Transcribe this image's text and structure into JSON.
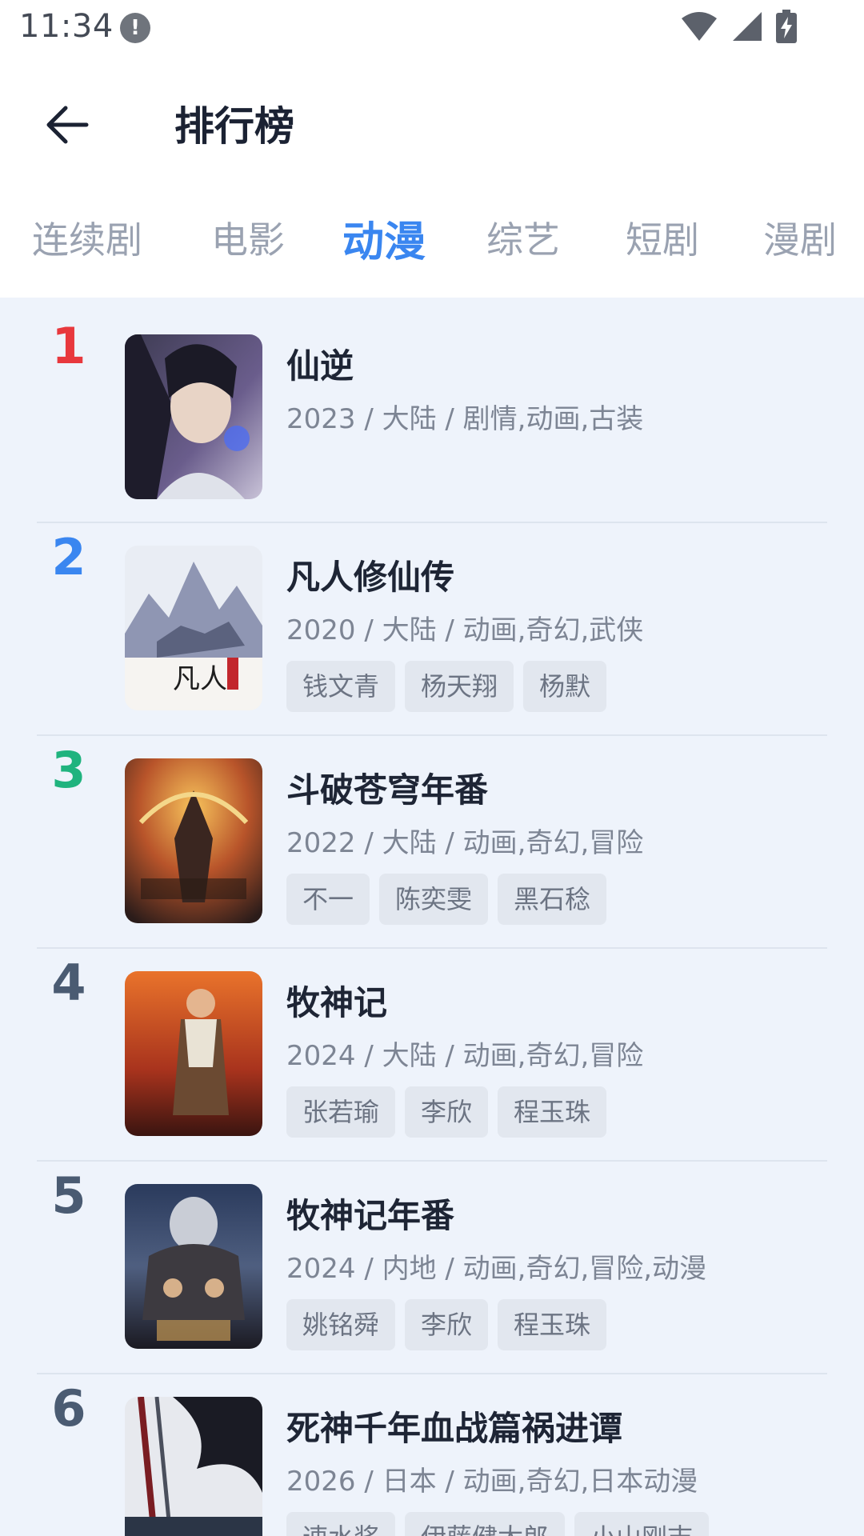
{
  "status_bar": {
    "time": "11:34",
    "alert": "!"
  },
  "header": {
    "title": "排行榜"
  },
  "tabs": [
    {
      "label": "连续剧",
      "active": false
    },
    {
      "label": "电影",
      "active": false
    },
    {
      "label": "动漫",
      "active": true
    },
    {
      "label": "综艺",
      "active": false
    },
    {
      "label": "短剧",
      "active": false
    },
    {
      "label": "漫剧",
      "active": false
    }
  ],
  "colors": {
    "accent": "#3a86f0",
    "rank1": "#e8383d",
    "rank2": "#3a86f0",
    "rank3": "#1fb37e",
    "rank_default": "#4a5b72"
  },
  "items": [
    {
      "rank": "1",
      "title": "仙逆",
      "meta": "2023 / 大陆 / 剧情,动画,古装",
      "tags": []
    },
    {
      "rank": "2",
      "title": "凡人修仙传",
      "meta": "2020 / 大陆 / 动画,奇幻,武侠",
      "tags": [
        "钱文青",
        "杨天翔",
        "杨默"
      ]
    },
    {
      "rank": "3",
      "title": "斗破苍穹年番",
      "meta": "2022 / 大陆 / 动画,奇幻,冒险",
      "tags": [
        "不一",
        "陈奕雯",
        "黑石稔"
      ]
    },
    {
      "rank": "4",
      "title": "牧神记",
      "meta": "2024 / 大陆 / 动画,奇幻,冒险",
      "tags": [
        "张若瑜",
        "李欣",
        "程玉珠"
      ]
    },
    {
      "rank": "5",
      "title": "牧神记年番",
      "meta": "2024 / 内地 / 动画,奇幻,冒险,动漫",
      "tags": [
        "姚铭舜",
        "李欣",
        "程玉珠"
      ]
    },
    {
      "rank": "6",
      "title": "死神千年血战篇祸进谭",
      "meta": "2026 / 日本 / 动画,奇幻,日本动漫",
      "tags": [
        "速水奖",
        "伊藤健太郎",
        "小山刚志"
      ]
    }
  ]
}
